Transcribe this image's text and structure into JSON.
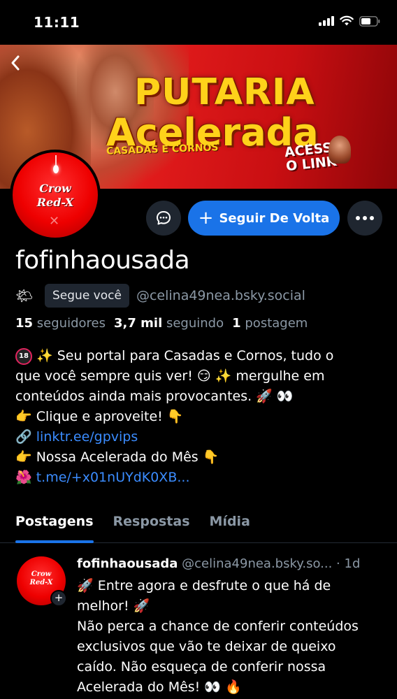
{
  "status_bar": {
    "time": "11:11"
  },
  "banner": {
    "title_line1": "PUTARIA",
    "title_line2": "Acelerada",
    "subtitle": "CASADAS E CORNOS",
    "cta_line1": "ACESSA",
    "cta_line2": "O LINK"
  },
  "avatar": {
    "line1": "Crow",
    "line2": "Red-X"
  },
  "actions": {
    "follow_label": "Seguir De Volta"
  },
  "profile": {
    "display_name": "fofinhaousada",
    "follows_you": "Segue você",
    "handle": "@celina49nea.bsky.social",
    "stats": {
      "followers_count": "15",
      "followers_label": "seguidores",
      "following_count": "3,7 mil",
      "following_label": "seguindo",
      "posts_count": "1",
      "posts_label": "postagem"
    },
    "bio": {
      "line1": "✨ Seu portal para Casadas e Cornos, tudo o",
      "line2": "que você sempre quis ver! 😏 ✨ mergulhe em",
      "line3": "conteúdos ainda mais provocantes. 🚀 👀",
      "line4": "👉 Clique e aproveite! 👇",
      "link1": "linktr.ee/gpvips",
      "line6": "👉 Nossa Acelerada do Mês 👇",
      "link2": "t.me/+x01nUYdK0XB..."
    }
  },
  "tabs": [
    {
      "label": "Postagens"
    },
    {
      "label": "Respostas"
    },
    {
      "label": "Mídia"
    }
  ],
  "post": {
    "author": "fofinhaousada",
    "handle": "@celina49nea.bsky.so...",
    "time": "· 1d",
    "line1": "🚀 Entre agora e desfrute o que há de",
    "line2": "melhor! 🚀",
    "line3": "Não perca a chance de conferir conteúdos",
    "line4": "exclusivos que vão te deixar de queixo",
    "line5": "caído. Não esqueça de conferir nossa",
    "line6": "Acelerada do Mês! 👀 🔥"
  },
  "colors": {
    "accent": "#1a73e8",
    "muted_text": "#8b98a5",
    "surface": "#1f2630"
  }
}
